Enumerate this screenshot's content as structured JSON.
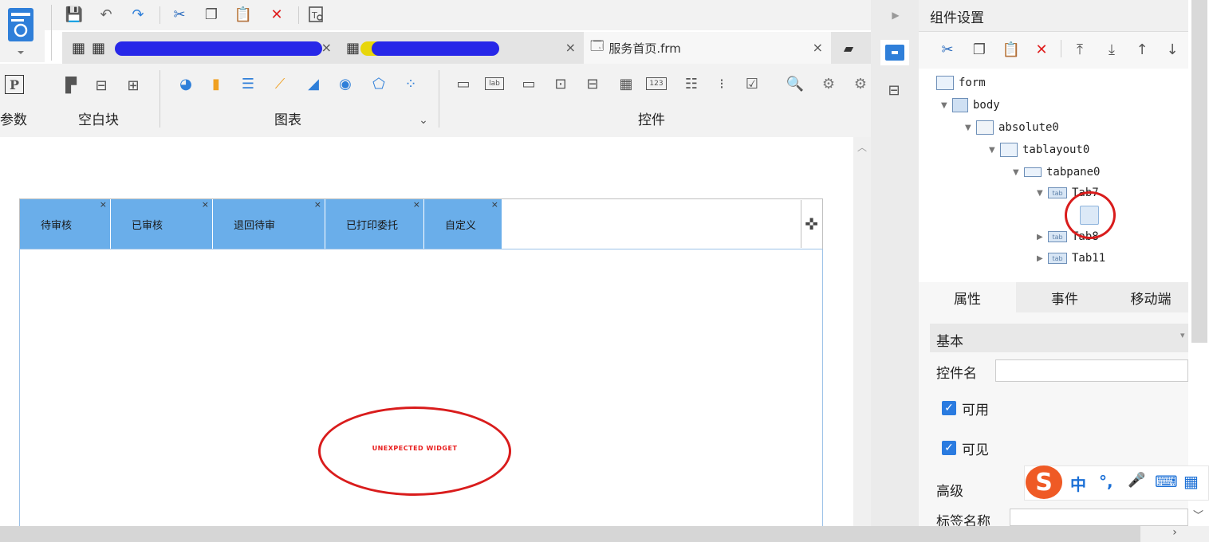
{
  "file_tabs": [
    {
      "label": "",
      "redacted": true
    },
    {
      "label": "",
      "redacted": true
    },
    {
      "label": "服务首页.frm",
      "redacted": false
    }
  ],
  "ribbon": {
    "groups": [
      "参数",
      "空白块",
      "图表",
      "控件"
    ]
  },
  "canvas": {
    "widget_tabs": [
      "待审核",
      "已审核",
      "退回待审",
      "已打印委托",
      "自定义"
    ],
    "warning_text": "UNEXPECTED WIDGET"
  },
  "panel": {
    "title": "组件设置",
    "tree": [
      {
        "label": "form"
      },
      {
        "label": "body"
      },
      {
        "label": "absolute0"
      },
      {
        "label": "tablayout0"
      },
      {
        "label": "tabpane0"
      },
      {
        "label": "Tab7"
      },
      {
        "label": "Tab8"
      },
      {
        "label": "Tab11"
      }
    ],
    "prop_tabs": [
      "属性",
      "事件",
      "移动端"
    ],
    "section_basic": "基本",
    "widget_name_label": "控件名",
    "widget_name_value": "",
    "enabled_label": "可用",
    "visible_label": "可见",
    "section_advanced": "高级",
    "tag_name_label": "标签名称"
  },
  "ime": {
    "items": [
      "中",
      "°,",
      "🎤",
      "⌨",
      "▦"
    ]
  },
  "colors": {
    "tab_fill": "#6aaeea",
    "annotation_red": "#d91c1c",
    "checkbox_blue": "#2a7be0"
  }
}
